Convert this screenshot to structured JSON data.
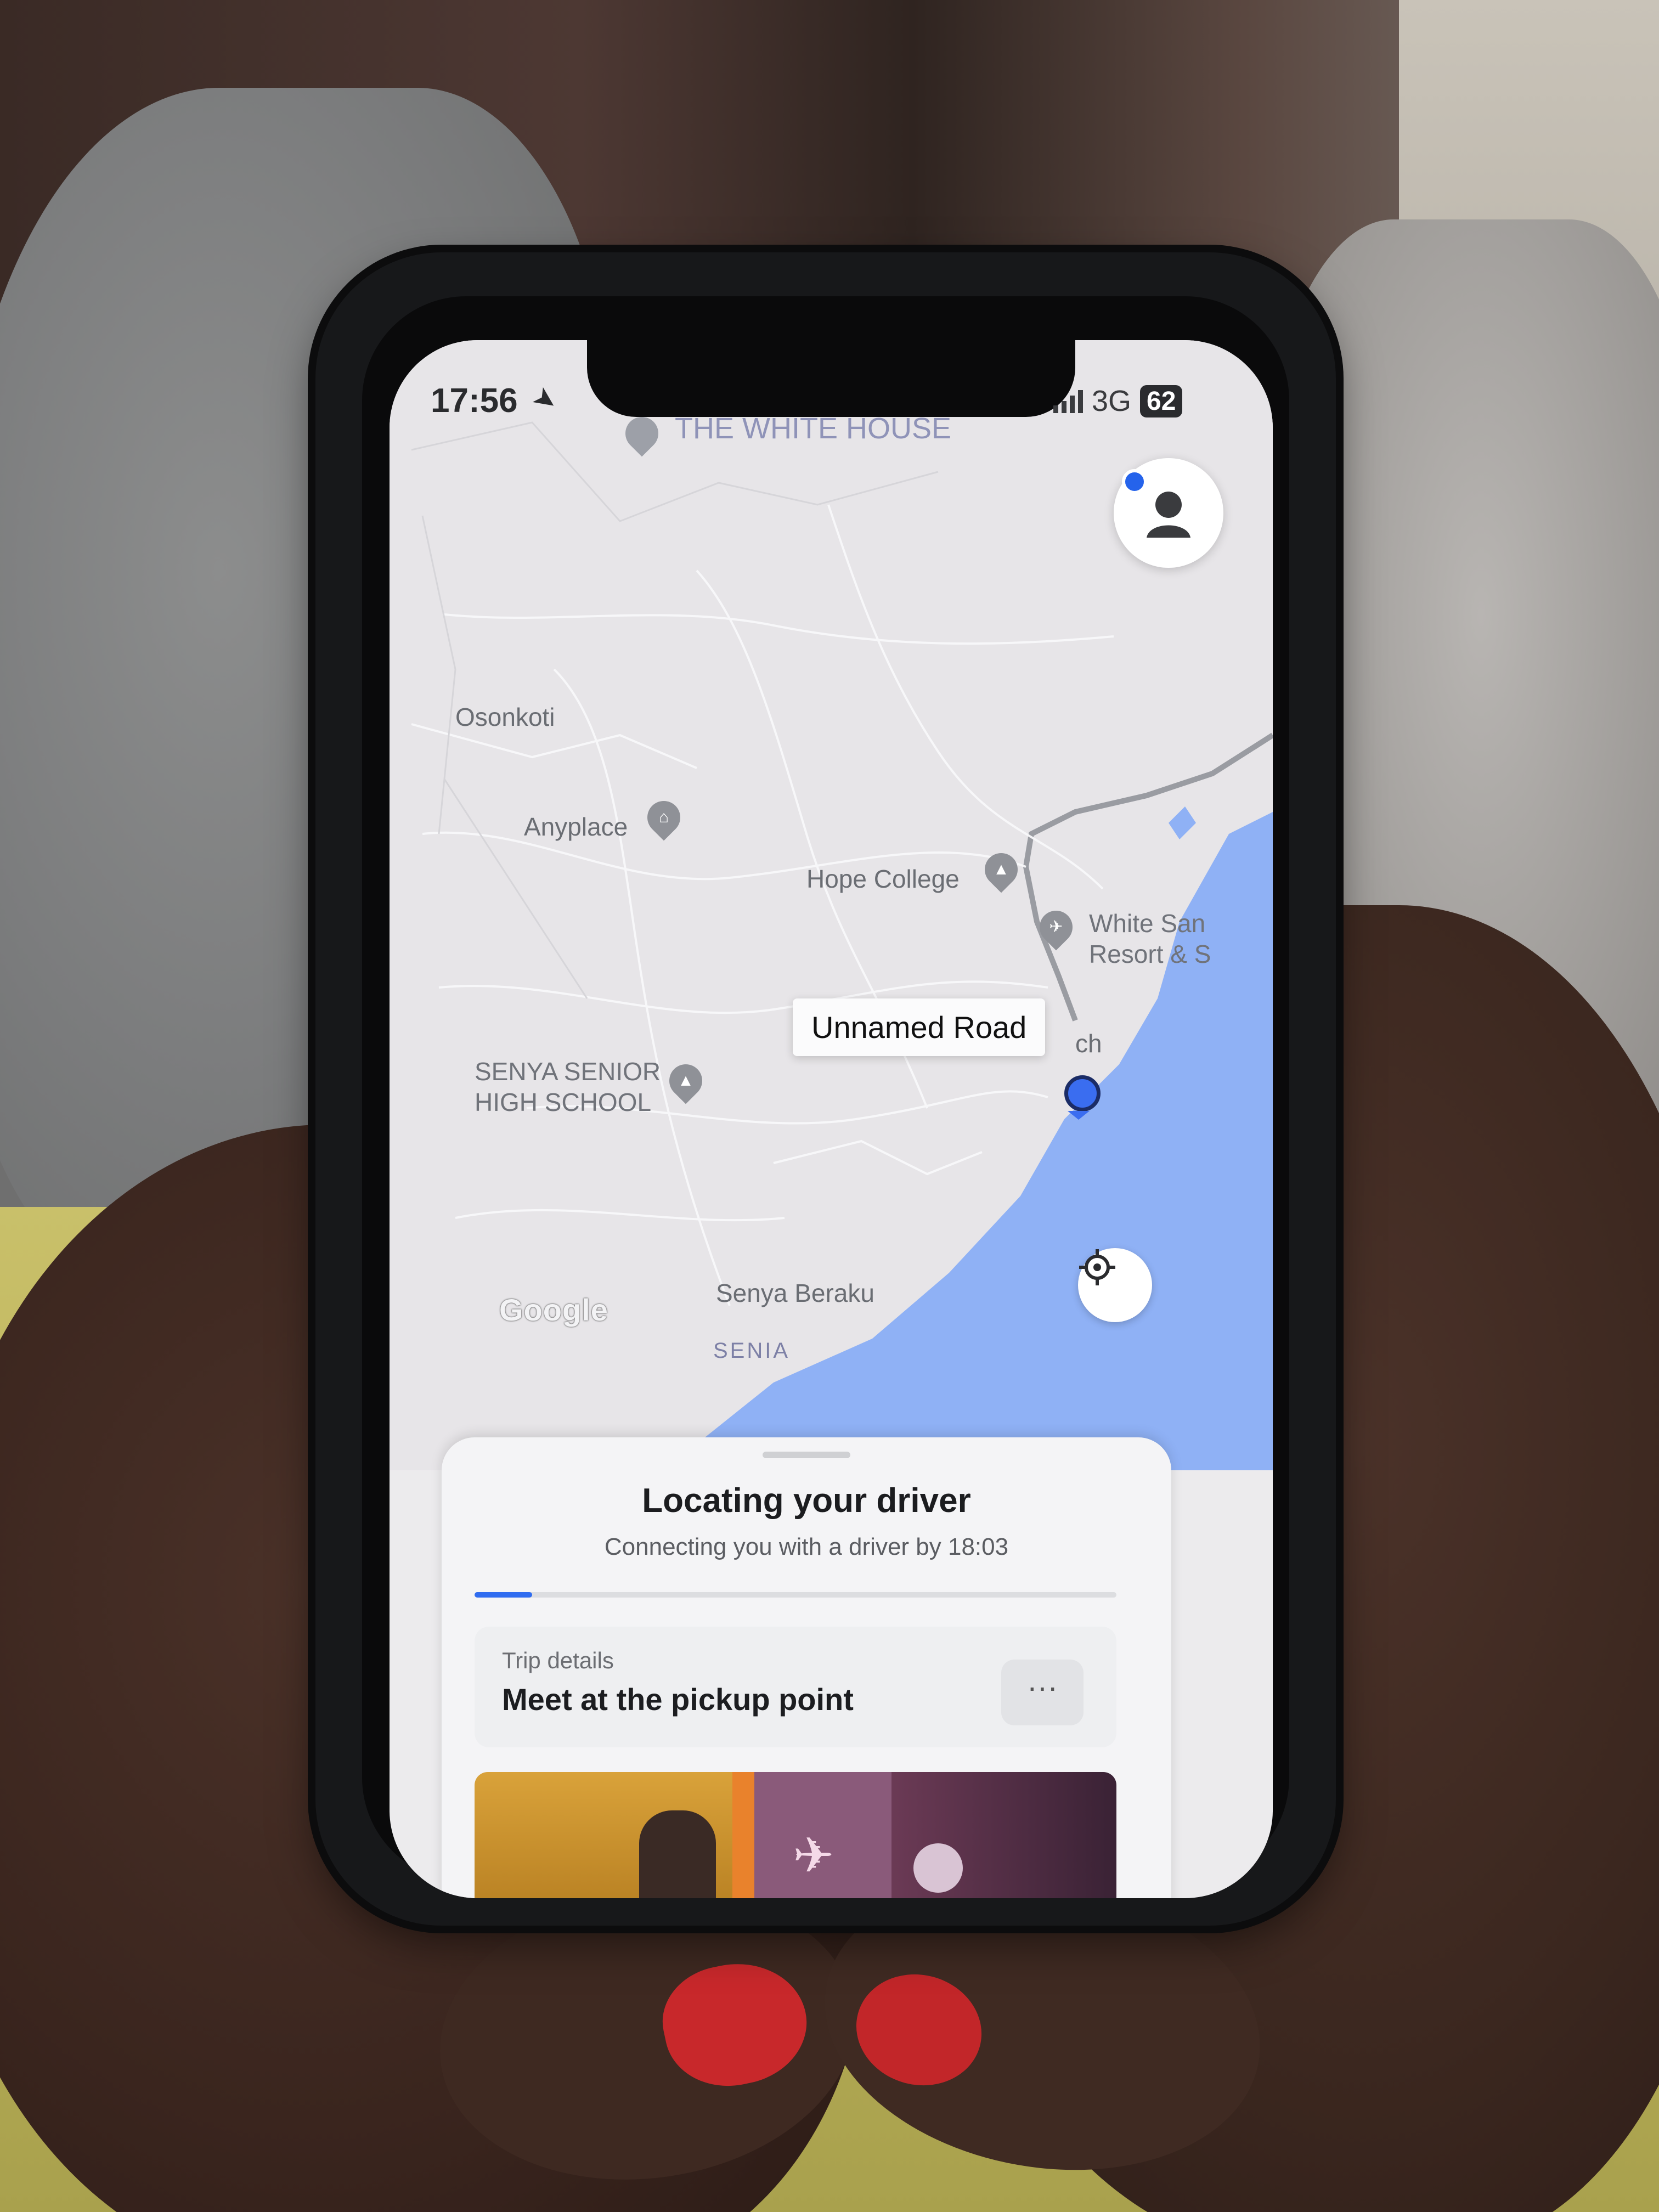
{
  "status_bar": {
    "time": "17:56",
    "network": "3G",
    "battery": "62"
  },
  "map": {
    "top_label": "THE WHITE HOUSE",
    "labels": {
      "osonkoti": "Osonkoti",
      "anyplace": "Anyplace",
      "hope_college": "Hope College",
      "white_sands_line1": "White San",
      "white_sands_line2": "Resort & S",
      "senya_school_line1": "SENYA SENIOR",
      "senya_school_line2": "HIGH SCHOOL",
      "senya_beraku": "Senya Beraku",
      "senia": "SENIA",
      "partial_beach": "ch"
    },
    "road_tooltip": "Unnamed Road",
    "attribution": "Google"
  },
  "sheet": {
    "title": "Locating your driver",
    "subtitle": "Connecting you with a driver by 18:03",
    "progress_fraction": 0.09,
    "trip_caption": "Trip details",
    "trip_main": "Meet at the pickup point",
    "more_label": "···"
  },
  "colors": {
    "water": "#8fb1f5",
    "accent_blue": "#2f6cf0",
    "land": "#e7e5e8"
  },
  "icons": {
    "profile": "person-icon",
    "locate": "crosshair-icon",
    "location_arrow": "location-arrow-icon"
  }
}
